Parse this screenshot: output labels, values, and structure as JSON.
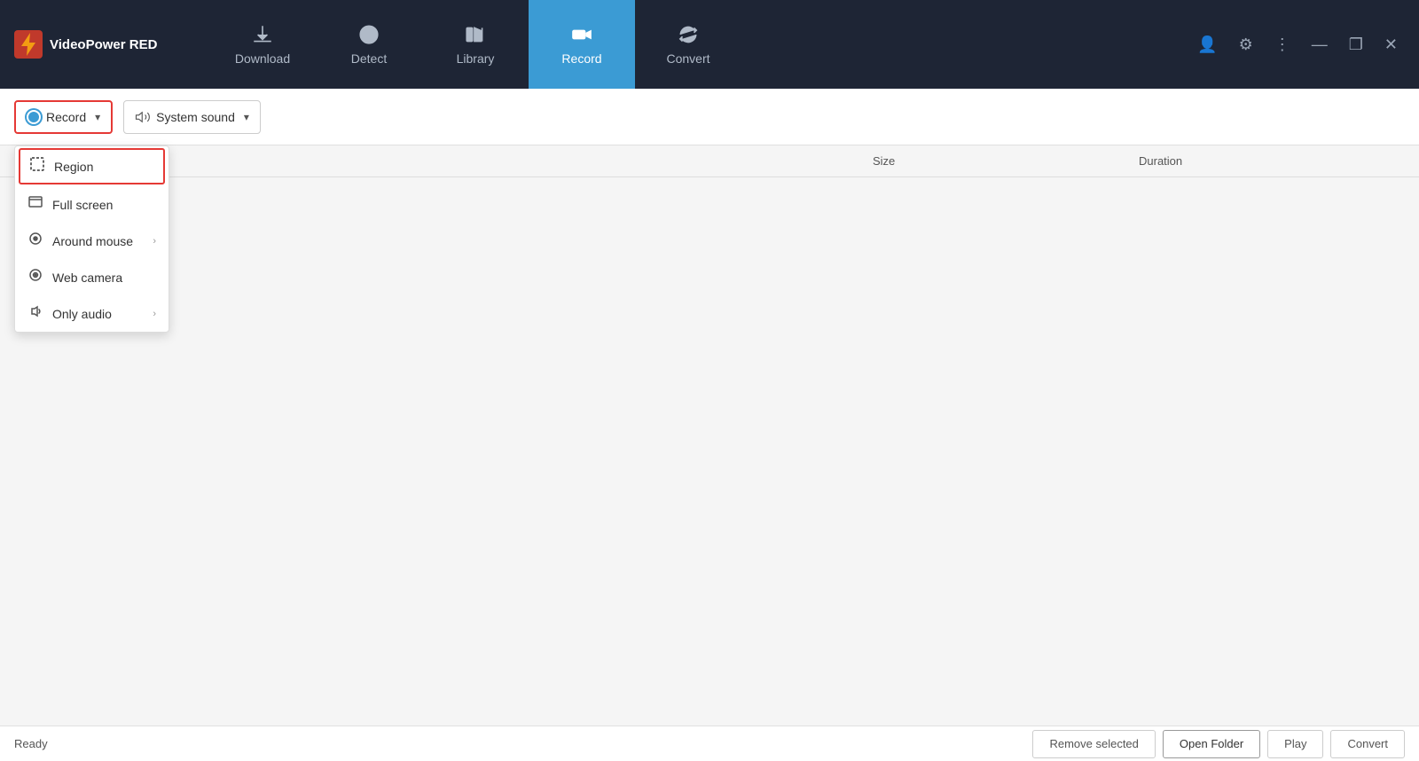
{
  "app": {
    "title": "VideoPower RED"
  },
  "nav": {
    "tabs": [
      {
        "id": "download",
        "label": "Download",
        "icon": "download"
      },
      {
        "id": "detect",
        "label": "Detect",
        "icon": "detect"
      },
      {
        "id": "library",
        "label": "Library",
        "icon": "library"
      },
      {
        "id": "record",
        "label": "Record",
        "icon": "record",
        "active": true
      },
      {
        "id": "convert",
        "label": "Convert",
        "icon": "convert"
      }
    ]
  },
  "toolbar": {
    "record_label": "Record",
    "system_sound_label": "System sound"
  },
  "dropdown": {
    "items": [
      {
        "id": "region",
        "label": "Region",
        "selected": true
      },
      {
        "id": "fullscreen",
        "label": "Full screen",
        "selected": false
      },
      {
        "id": "around-mouse",
        "label": "Around mouse",
        "selected": false,
        "has_sub": true
      },
      {
        "id": "web-camera",
        "label": "Web camera",
        "selected": false
      },
      {
        "id": "only-audio",
        "label": "Only audio",
        "selected": false,
        "has_sub": true
      }
    ]
  },
  "table": {
    "columns": {
      "name": "",
      "size": "Size",
      "duration": "Duration"
    }
  },
  "statusbar": {
    "status": "Ready",
    "buttons": {
      "remove_selected": "Remove selected",
      "open_folder": "Open Folder",
      "play": "Play",
      "convert": "Convert"
    }
  },
  "window_controls": {
    "minimize": "—",
    "maximize": "❐",
    "close": "✕"
  }
}
